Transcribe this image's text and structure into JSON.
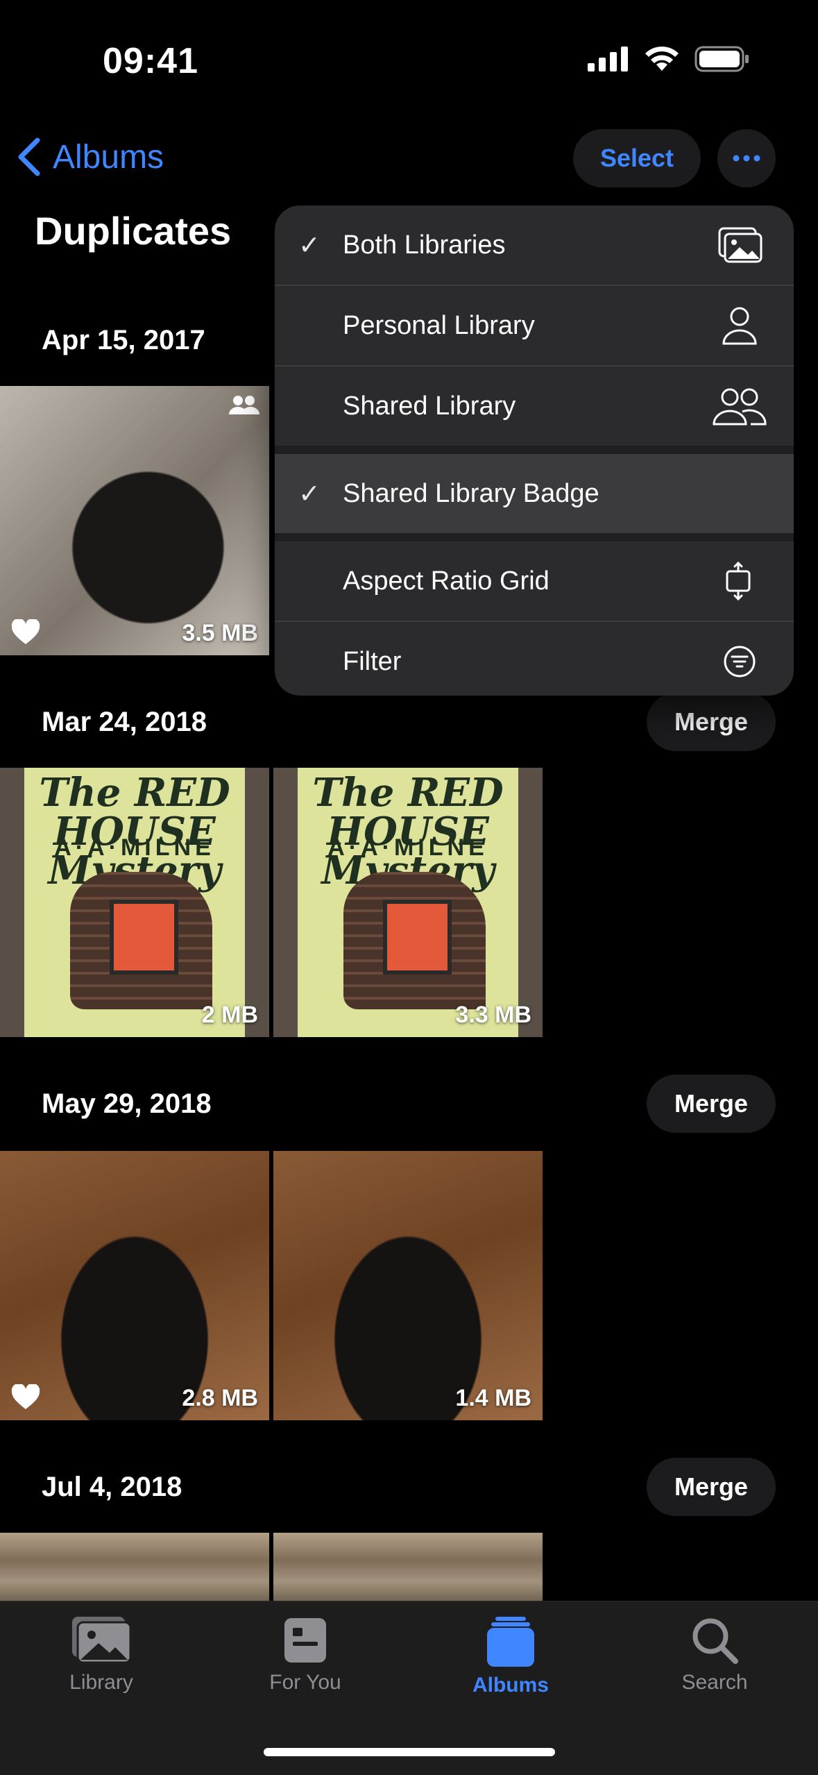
{
  "status": {
    "time": "09:41"
  },
  "nav": {
    "back_label": "Albums",
    "select_label": "Select"
  },
  "page": {
    "title": "Duplicates"
  },
  "menu": {
    "items": [
      {
        "label": "Both Libraries",
        "checked": true,
        "icon": "photo-stack-icon"
      },
      {
        "label": "Personal Library",
        "checked": false,
        "icon": "person-icon"
      },
      {
        "label": "Shared Library",
        "checked": false,
        "icon": "two-person-icon"
      },
      {
        "label": "Shared Library Badge",
        "checked": true,
        "icon": ""
      },
      {
        "label": "Aspect Ratio Grid",
        "checked": false,
        "icon": "aspect-ratio-icon"
      },
      {
        "label": "Filter",
        "checked": false,
        "icon": "filter-icon"
      }
    ],
    "check_glyph": "✓"
  },
  "groups": [
    {
      "date": "Apr 15, 2017",
      "photos": [
        {
          "size": "3.5 MB",
          "favorite": true,
          "shared": true
        }
      ]
    },
    {
      "date": "Mar 24, 2018",
      "merge_label": "Merge",
      "photos": [
        {
          "size": "2 MB"
        },
        {
          "size": "3.3 MB"
        }
      ]
    },
    {
      "date": "May 29, 2018",
      "merge_label": "Merge",
      "photos": [
        {
          "size": "2.8 MB",
          "favorite": true
        },
        {
          "size": "1.4 MB"
        }
      ]
    },
    {
      "date": "Jul 4, 2018",
      "merge_label": "Merge",
      "photos": [
        {
          "size": ""
        },
        {
          "size": ""
        }
      ]
    }
  ],
  "book": {
    "title": "The RED HOUSE Mystery",
    "author": "A·A·MILNE"
  },
  "tabs": [
    {
      "label": "Library",
      "icon": "photos-icon",
      "active": false
    },
    {
      "label": "For You",
      "icon": "for-you-icon",
      "active": false
    },
    {
      "label": "Albums",
      "icon": "albums-icon",
      "active": true
    },
    {
      "label": "Search",
      "icon": "search-icon",
      "active": false
    }
  ],
  "colors": {
    "accent": "#3f86ff",
    "menu_bg": "#2c2c2e"
  }
}
